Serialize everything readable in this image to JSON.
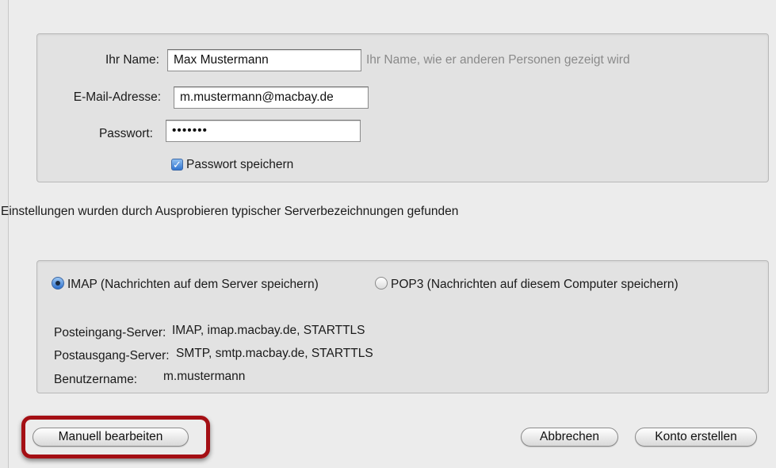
{
  "account": {
    "name_label": "Ihr Name:",
    "name_value": "Max Mustermann",
    "name_hint": "Ihr Name, wie er anderen Personen gezeigt wird",
    "email_label": "E-Mail-Adresse:",
    "email_value": "m.mustermann@macbay.de",
    "password_label": "Passwort:",
    "password_value": "•••••••",
    "save_password_label": "Passwort speichern",
    "save_password_checked": true
  },
  "status_text": "Einstellungen wurden durch Ausprobieren typischer Serverbezeichnungen gefunden",
  "server": {
    "imap_label": "IMAP (Nachrichten auf dem Server speichern)",
    "pop3_label": "POP3 (Nachrichten auf diesem Computer speichern)",
    "selected": "IMAP",
    "incoming_label": "Posteingang-Server:",
    "incoming_value": "IMAP, imap.macbay.de, STARTTLS",
    "outgoing_label": "Postausgang-Server:",
    "outgoing_value": "SMTP, smtp.macbay.de, STARTTLS",
    "username_label": "Benutzername:",
    "username_value": "m.mustermann"
  },
  "buttons": {
    "manual_edit": "Manuell bearbeiten",
    "cancel": "Abbrechen",
    "create_account": "Konto erstellen"
  },
  "colors": {
    "highlight": "#a40f14",
    "accent": "#2f74d0"
  }
}
